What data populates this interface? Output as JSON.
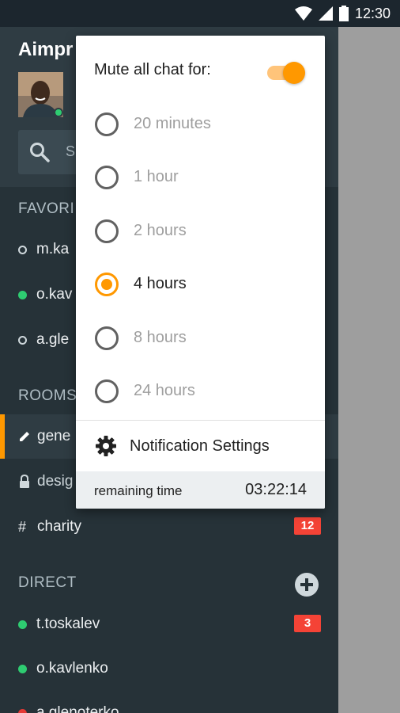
{
  "status_bar": {
    "time": "12:30",
    "icons": [
      "wifi-icon",
      "signal-icon",
      "battery-icon"
    ]
  },
  "drawer": {
    "app_title": "Aimpr",
    "avatar_status": "online",
    "search_placeholder": "S",
    "sections": {
      "favorites": "FAVORI",
      "rooms": "ROOMS",
      "direct": "DIRECT"
    },
    "favorites": [
      {
        "label": "m.ka",
        "status": "offline"
      },
      {
        "label": "o.kav",
        "status": "online"
      },
      {
        "label": "a.gle",
        "status": "offline"
      }
    ],
    "rooms": [
      {
        "label": "gene",
        "icon": "pencil-icon",
        "active": true
      },
      {
        "label": "desig",
        "icon": "lock-icon",
        "active": false
      },
      {
        "label": "charity",
        "icon": "hash-icon",
        "prefix": "#",
        "badge": "12"
      }
    ],
    "direct": [
      {
        "label": "t.toskalev",
        "status": "online",
        "badge": "3"
      },
      {
        "label": "o.kavlenko",
        "status": "online"
      },
      {
        "label": "a.glenoterko",
        "status": "busy"
      }
    ]
  },
  "mute_popup": {
    "title": "Mute all chat for:",
    "toggle_on": true,
    "options": [
      {
        "label": "20 minutes",
        "selected": false
      },
      {
        "label": "1 hour",
        "selected": false
      },
      {
        "label": "2 hours",
        "selected": false
      },
      {
        "label": "4 hours",
        "selected": true
      },
      {
        "label": "8 hours",
        "selected": false
      },
      {
        "label": "24 hours",
        "selected": false
      }
    ],
    "notification_settings": "Notification Settings",
    "remaining_label": "remaining time",
    "remaining_value": "03:22:14"
  },
  "colors": {
    "accent": "#ff9800",
    "drawer_bg": "#263238",
    "badge": "#f44336",
    "online": "#2ecc71"
  }
}
